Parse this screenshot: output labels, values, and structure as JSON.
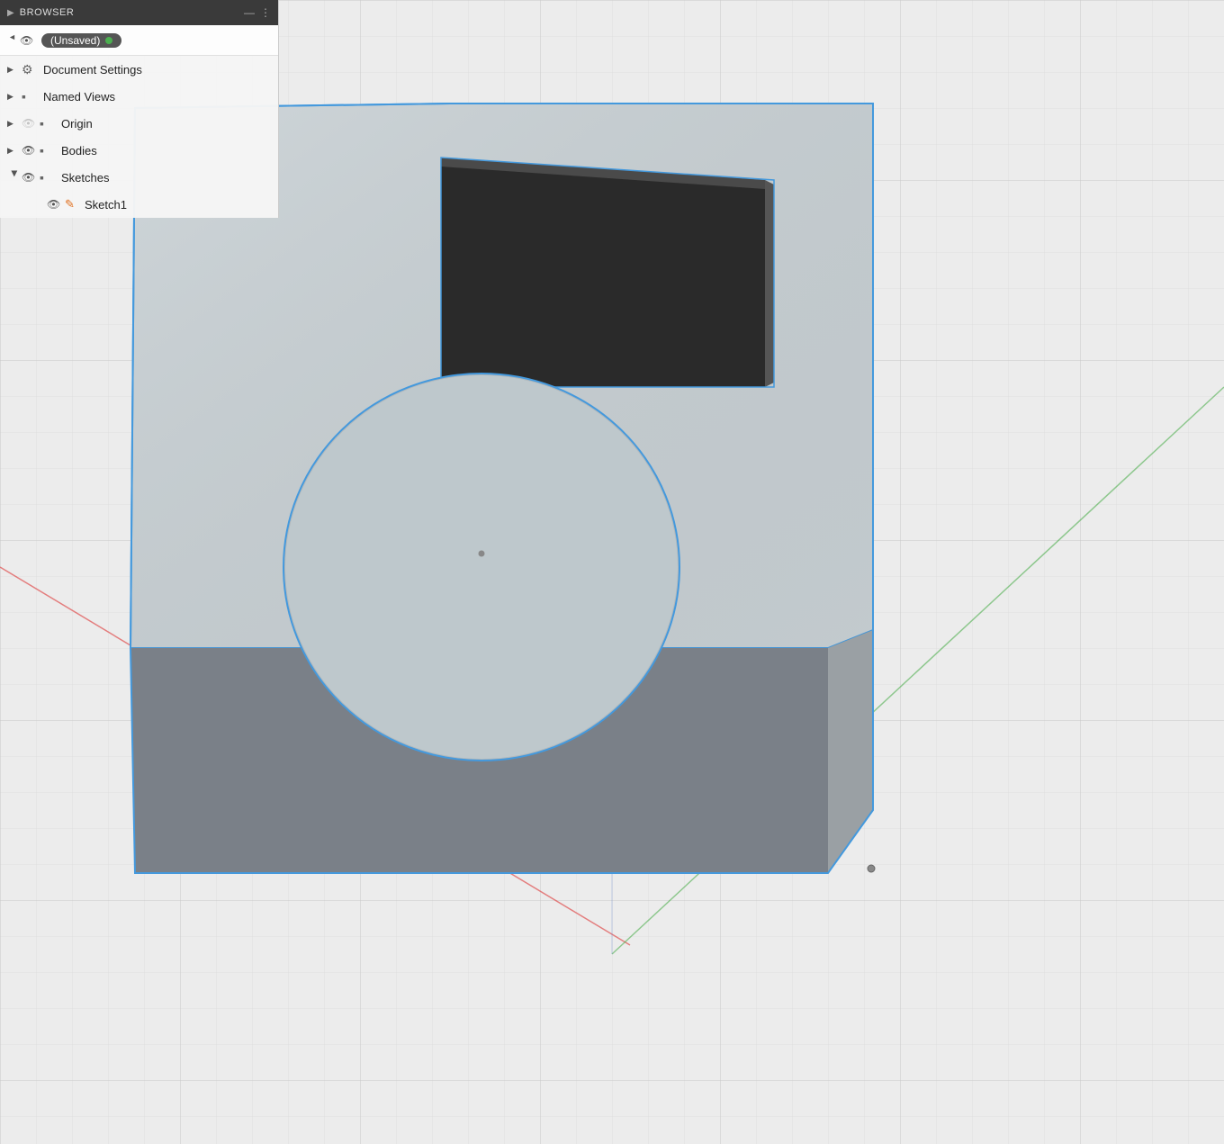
{
  "browser": {
    "title": "BROWSER",
    "collapse_arrow": "◀",
    "header_icons": [
      "—",
      "⋮"
    ],
    "root_item": {
      "label": "(Unsaved)",
      "badge_dot_color": "#4CAF50"
    },
    "items": [
      {
        "id": "document-settings",
        "type": "collapsed",
        "has_eye": false,
        "icon_type": "gear",
        "label": "Document Settings",
        "depth": 1
      },
      {
        "id": "named-views",
        "type": "collapsed",
        "has_eye": false,
        "icon_type": "folder",
        "label": "Named Views",
        "depth": 1
      },
      {
        "id": "origin",
        "type": "collapsed",
        "has_eye": true,
        "eye_hidden": true,
        "icon_type": "folder",
        "label": "Origin",
        "depth": 1
      },
      {
        "id": "bodies",
        "type": "collapsed",
        "has_eye": true,
        "eye_hidden": false,
        "icon_type": "folder",
        "label": "Bodies",
        "depth": 1
      },
      {
        "id": "sketches",
        "type": "expanded",
        "has_eye": true,
        "eye_hidden": false,
        "icon_type": "folder",
        "label": "Sketches",
        "depth": 1
      },
      {
        "id": "sketch1",
        "type": "child",
        "has_eye": true,
        "eye_hidden": false,
        "icon_type": "sketch",
        "label": "Sketch1",
        "depth": 2
      }
    ]
  },
  "viewport": {
    "background_color": "#e8e8e8",
    "grid_color": "#d8d8d8"
  },
  "icons": {
    "eye_open": "👁",
    "eye_hidden": "◎",
    "folder": "▪",
    "gear": "⚙",
    "triangle_right": "▶",
    "triangle_down": "▼",
    "minus": "−"
  }
}
